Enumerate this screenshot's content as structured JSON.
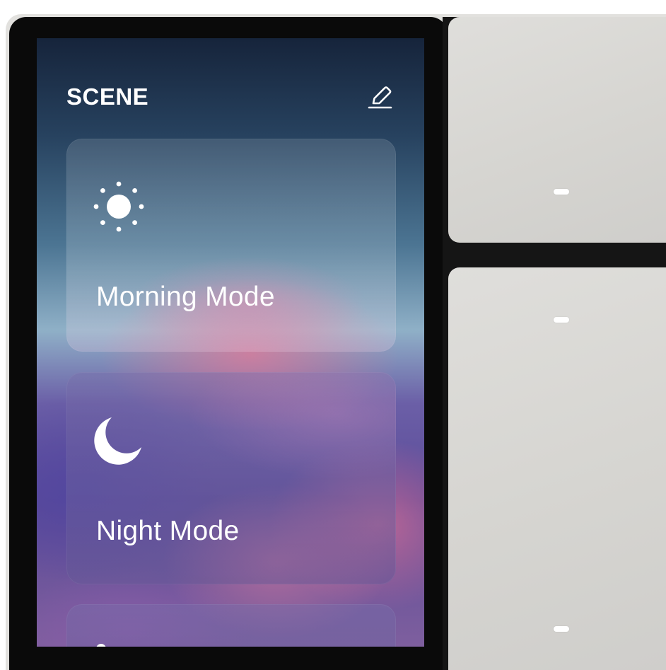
{
  "screen": {
    "title": "SCENE",
    "edit_icon": "pencil-edit-icon"
  },
  "scenes": [
    {
      "label": "Morning Mode",
      "icon": "sun-icon"
    },
    {
      "label": "Night Mode",
      "icon": "moon-icon"
    },
    {
      "label": "",
      "icon": "partial-icon"
    }
  ],
  "panel": {
    "switches": [
      "top-switch",
      "bottom-switch"
    ]
  },
  "colors": {
    "text": "#ffffff",
    "frame": "#0a0a0a",
    "switch_surface": "#d8d7d4",
    "indicator": "#ffffff"
  }
}
